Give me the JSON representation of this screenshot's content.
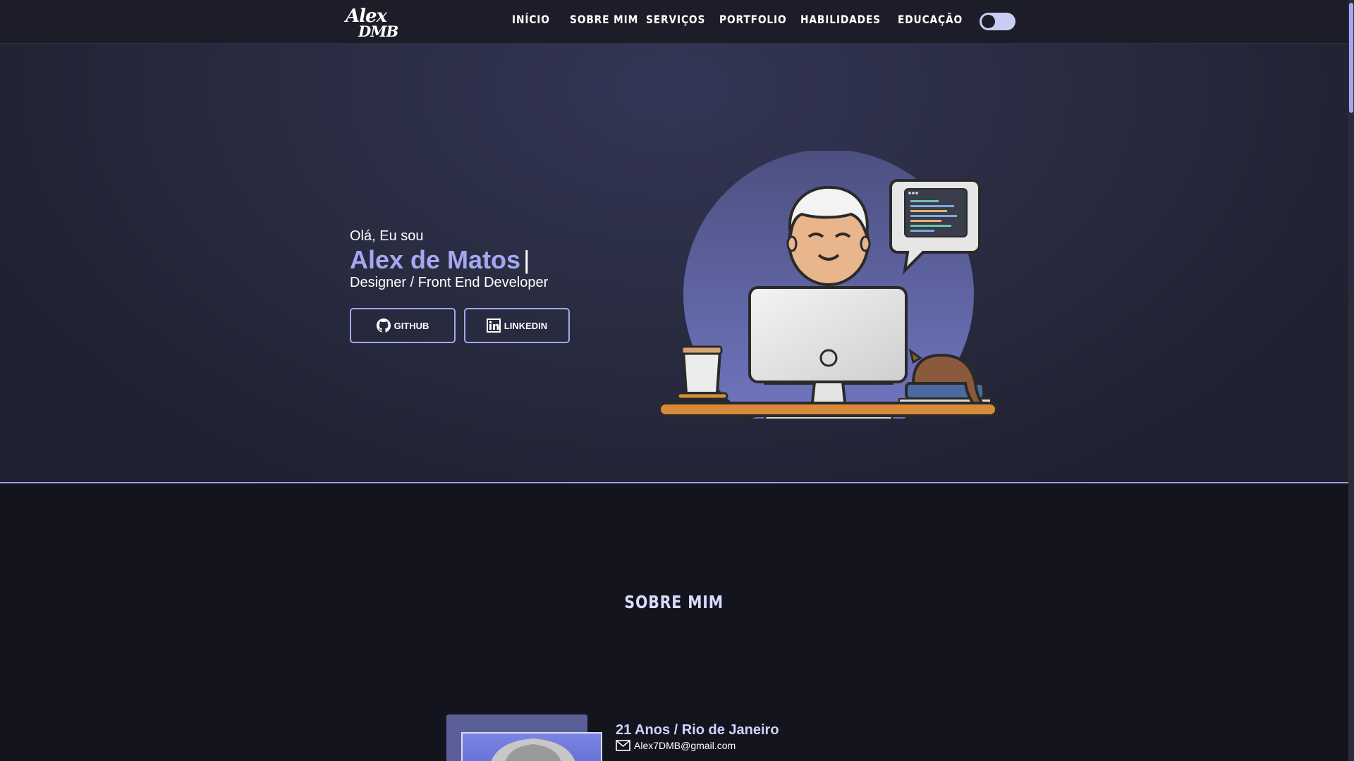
{
  "header": {
    "logo_line1": "Alex",
    "logo_line2": "DMB",
    "nav": [
      "INÍCIO",
      "SOBRE MIM",
      "SERVIÇOS",
      "PORTFOLIO",
      "HABILIDADES",
      "EDUCAÇÃO"
    ],
    "theme_toggle": "theme-toggle"
  },
  "hero": {
    "greeting": "Olá, Eu sou",
    "name": "Alex de Matos",
    "cursor": "|",
    "role": "Designer / Front End Developer",
    "buttons": {
      "github": "GITHUB",
      "linkedin": "LINKEDIN"
    },
    "illustration": "developer-at-desk-illustration"
  },
  "about": {
    "title": "SOBRE MIM",
    "age_location": "21 Anos / Rio de Janeiro",
    "email": "Alex7DMB@gmail.com"
  },
  "colors": {
    "accent": "#a3a8ef",
    "header_bg": "#1c1d28",
    "page_bg": "#13141d",
    "hero_bg": "#2a2c42"
  },
  "icons": [
    "github-icon",
    "linkedin-icon",
    "mail-icon"
  ]
}
